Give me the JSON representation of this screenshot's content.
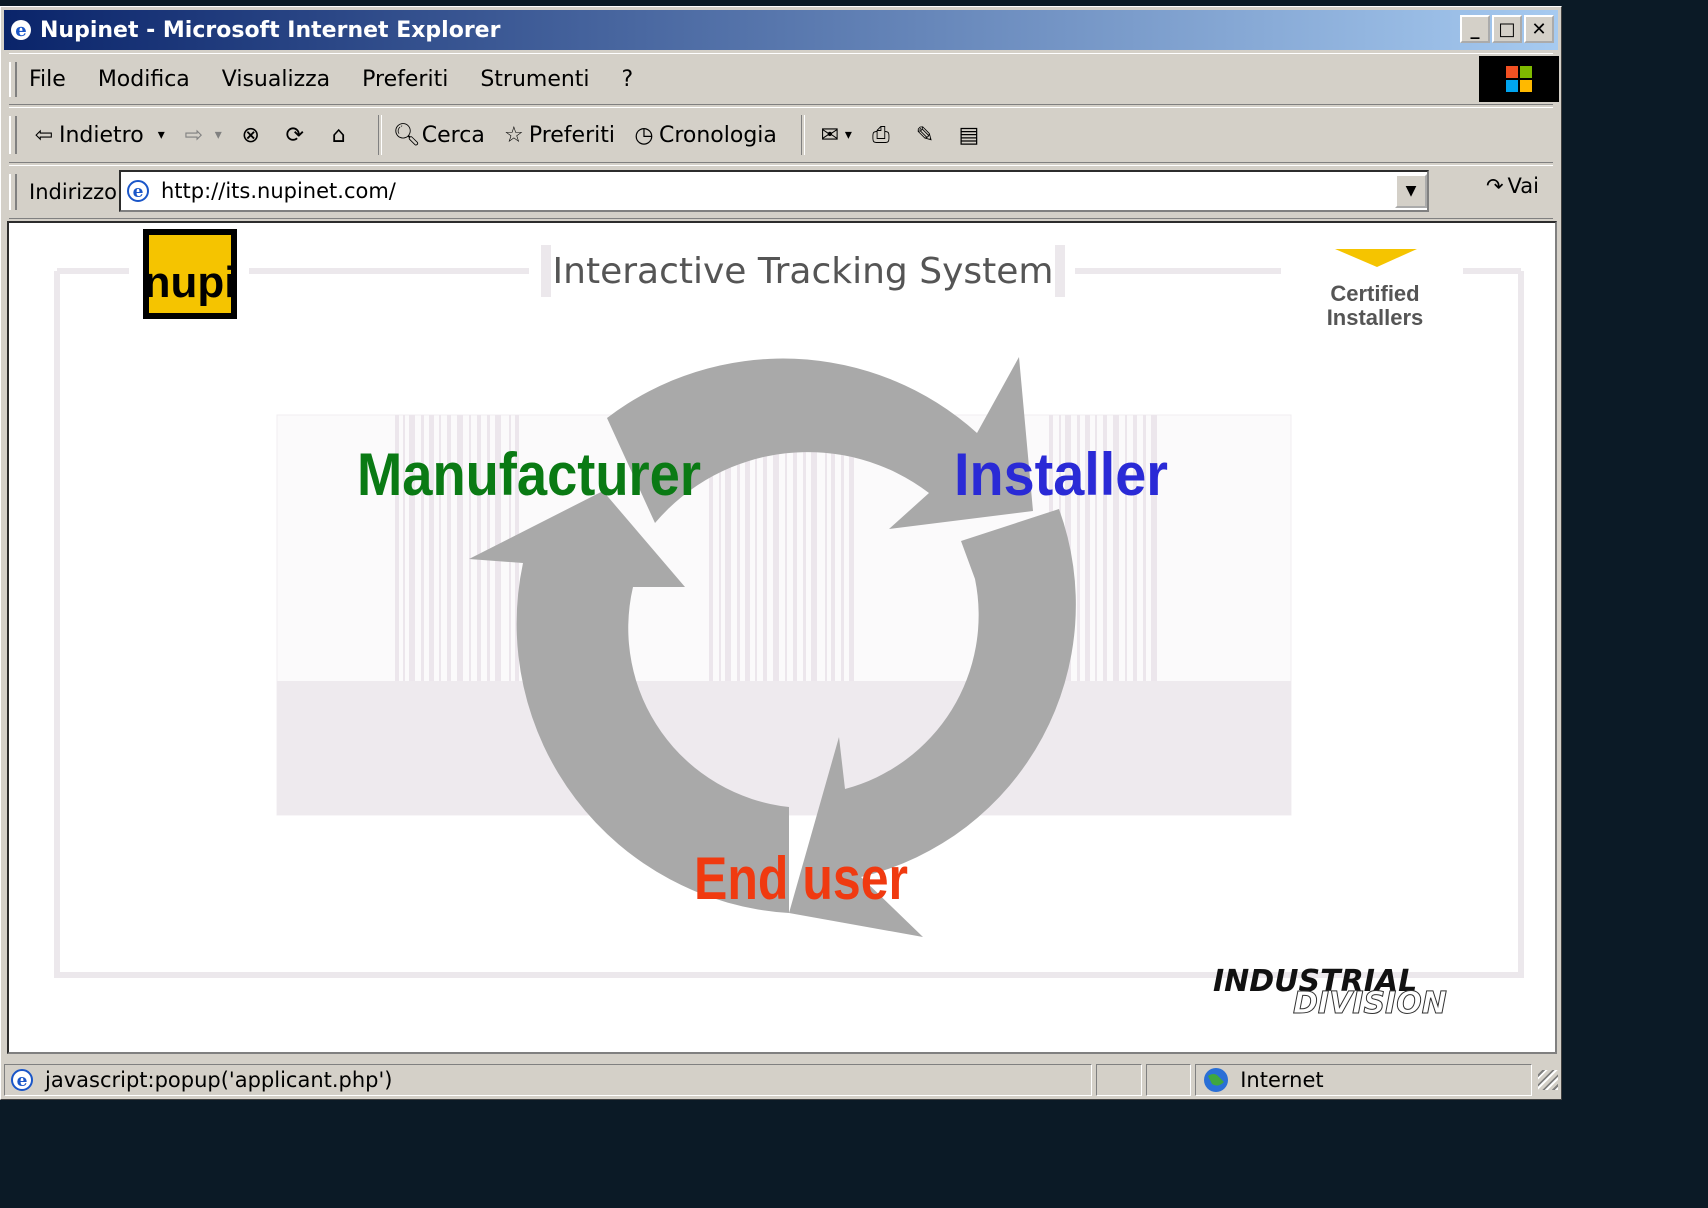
{
  "window": {
    "title": "Nupinet - Microsoft Internet Explorer"
  },
  "menu": {
    "items": [
      "File",
      "Modifica",
      "Visualizza",
      "Preferiti",
      "Strumenti",
      "?"
    ]
  },
  "toolbar": {
    "back_label": "Indietro",
    "search_label": "Cerca",
    "favorites_label": "Preferiti",
    "history_label": "Cronologia"
  },
  "address": {
    "label": "Indirizzo",
    "url": "http://its.nupinet.com/",
    "go_label": "Vai"
  },
  "page": {
    "logo_text": "nupi",
    "heading": "Interactive Tracking System",
    "certified_line1": "Certified",
    "certified_line2": "Installers",
    "cycle": {
      "manufacturer": "Manufacturer",
      "installer": "Installer",
      "end_user": "End user"
    },
    "division_line1": "INDUSTRIAL",
    "division_line2": "DIVISION"
  },
  "status": {
    "text": "javascript:popup('applicant.php')",
    "zone": "Internet"
  },
  "colors": {
    "manufacturer": "#0a7a14",
    "installer": "#2a2ad6",
    "end_user": "#f03a10",
    "arrow_gray": "#a9a9a9",
    "logo_yellow": "#f5c400"
  }
}
